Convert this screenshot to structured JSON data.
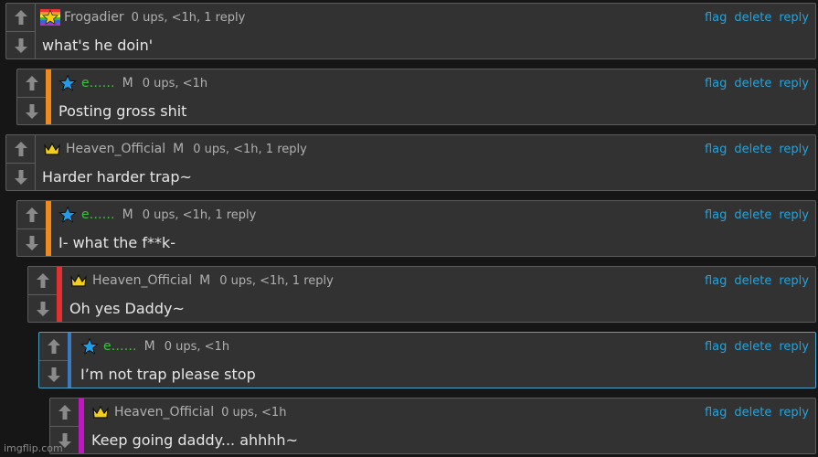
{
  "actions": {
    "flag": "flag",
    "delete": "delete",
    "reply": "reply"
  },
  "comments": [
    {
      "user": "Frogadier",
      "badge": "",
      "meta": "0 ups, <1h, 1 reply",
      "text": "what's he doin'",
      "avatar": "pride-star"
    },
    {
      "user": "e……",
      "badge": "M",
      "meta": "0 ups, <1h",
      "text": "Posting gross shit",
      "avatar": "blue-star"
    },
    {
      "user": "Heaven_Official",
      "badge": "M",
      "meta": "0 ups, <1h, 1 reply",
      "text": "Harder harder trap~",
      "avatar": "crown"
    },
    {
      "user": "e……",
      "badge": "M",
      "meta": "0 ups, <1h, 1 reply",
      "text": "I- what the f**k-",
      "avatar": "blue-star"
    },
    {
      "user": "Heaven_Official",
      "badge": "M",
      "meta": "0 ups, <1h, 1 reply",
      "text": "Oh yes Daddy~",
      "avatar": "crown"
    },
    {
      "user": "e……",
      "badge": "M",
      "meta": "0 ups, <1h",
      "text": "I’m not trap please stop",
      "avatar": "blue-star"
    },
    {
      "user": "Heaven_Official",
      "badge": "",
      "meta": "0 ups, <1h",
      "text": "Keep going daddy... ahhhh~",
      "avatar": "crown"
    }
  ],
  "colors": {
    "orange_thread": "#ef8a1b",
    "red_thread": "#e03030",
    "blue_thread": "#3a7bbf",
    "purple_thread": "#c018c0",
    "link": "#1ea5e0",
    "green_user": "#3fbf3f"
  },
  "watermark": "imgflip.com"
}
